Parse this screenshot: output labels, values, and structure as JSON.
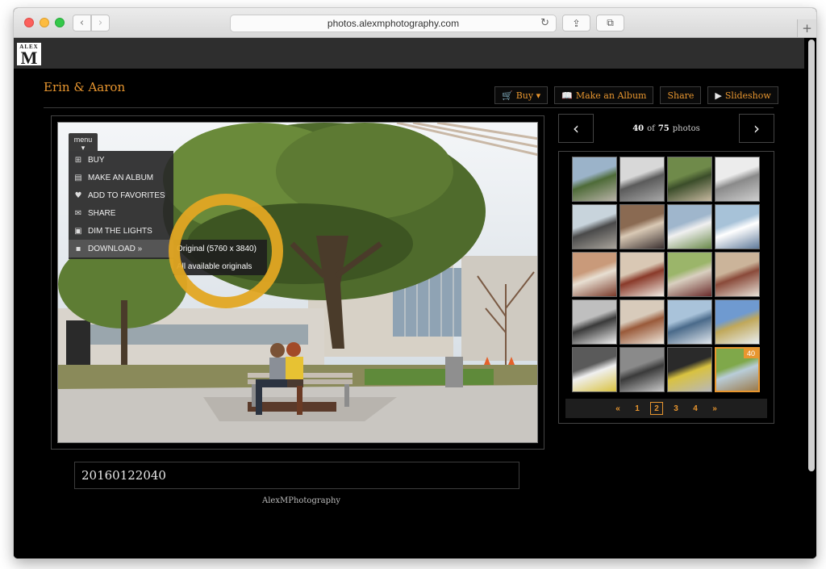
{
  "browser": {
    "url": "photos.alexmphotography.com"
  },
  "site": {
    "logo_small": "ALEX",
    "logo_big": "M",
    "gallery_title": "Erin & Aaron",
    "actions": [
      {
        "name": "buy-button",
        "icon": "cart-icon",
        "glyph": "🛒",
        "label": "Buy ▾"
      },
      {
        "name": "make-album-button",
        "icon": "book-icon",
        "glyph": "📖",
        "label": "Make an Album"
      },
      {
        "name": "share-button",
        "icon": "",
        "glyph": "",
        "label": "Share"
      },
      {
        "name": "slideshow-button",
        "icon": "play-icon",
        "glyph": "▶",
        "label": "Slideshow"
      }
    ]
  },
  "photo_menu": {
    "tab_label": "menu",
    "items": [
      {
        "name": "menu-item-buy",
        "icon": "cart-icon",
        "glyph": "⊞",
        "label": "BUY"
      },
      {
        "name": "menu-item-make-album",
        "icon": "book-icon",
        "glyph": "▤",
        "label": "MAKE AN ALBUM"
      },
      {
        "name": "menu-item-add-favorites",
        "icon": "heart-icon",
        "glyph": "♥",
        "label": "ADD TO FAVORITES"
      },
      {
        "name": "menu-item-share",
        "icon": "envelope-icon",
        "glyph": "✉",
        "label": "SHARE"
      },
      {
        "name": "menu-item-dim-lights",
        "icon": "dim-icon",
        "glyph": "▣",
        "label": "DIM THE LIGHTS"
      },
      {
        "name": "menu-item-download",
        "icon": "disk-icon",
        "glyph": "▪",
        "label": "DOWNLOAD »"
      }
    ],
    "download_options": [
      {
        "name": "download-original",
        "label": "Original (5760 x 3840)"
      },
      {
        "name": "download-all-originals",
        "label": "All available originals"
      }
    ]
  },
  "photo": {
    "caption": "20160122040",
    "credit": "AlexMPhotography"
  },
  "navigator": {
    "current": "40",
    "of_text": "of",
    "total": "75",
    "photos_text": "photos"
  },
  "thumbnails": {
    "current_badge": "40",
    "count": 20
  },
  "pager": {
    "prev": "«",
    "pages": [
      "1",
      "2",
      "3",
      "4"
    ],
    "current_page": "2",
    "next": "»"
  },
  "colors": {
    "accent": "#e8962f",
    "ring": "#e1a623"
  }
}
